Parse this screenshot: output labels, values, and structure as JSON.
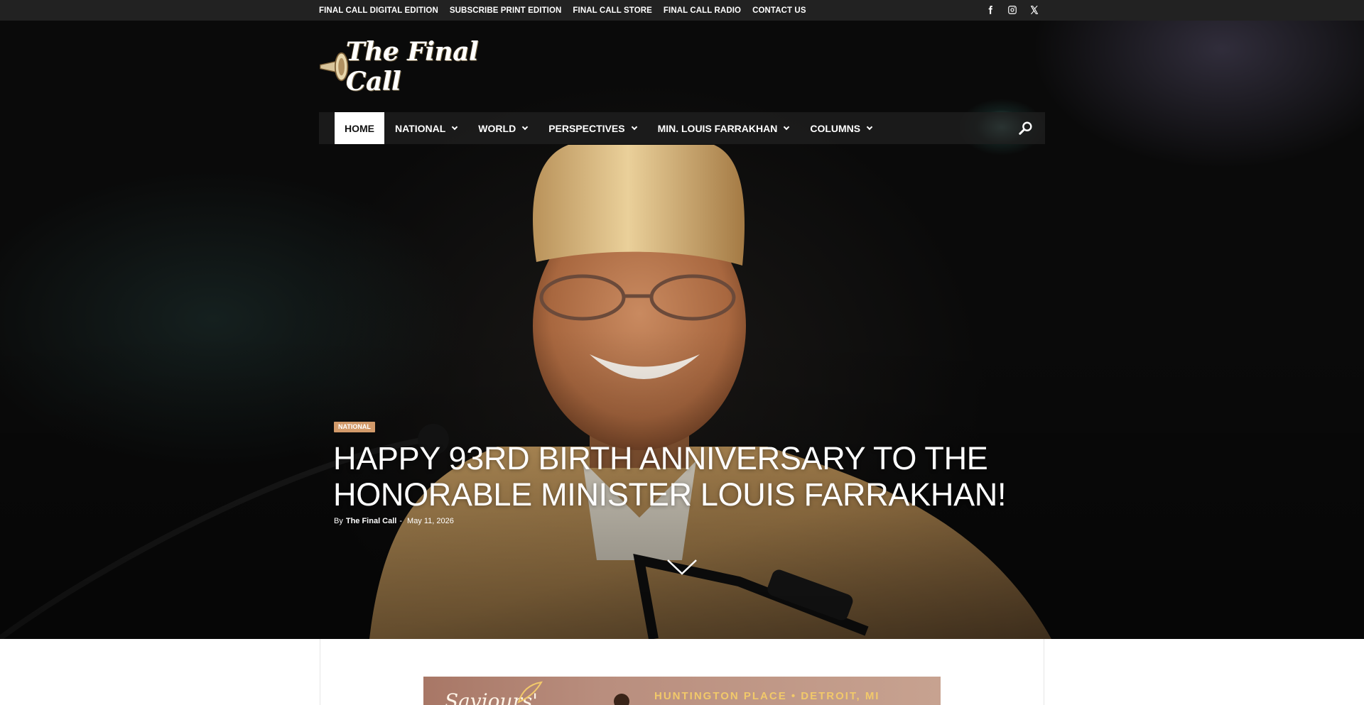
{
  "topbar": {
    "links": [
      "FINAL CALL DIGITAL EDITION",
      "SUBSCRIBE PRINT EDITION",
      "FINAL CALL STORE",
      "FINAL CALL RADIO",
      "CONTACT US"
    ],
    "socials": [
      "facebook-icon",
      "instagram-icon",
      "x-icon"
    ]
  },
  "logo": {
    "text": "The Final Call",
    "icon": "trumpet-icon"
  },
  "nav": {
    "items": [
      {
        "label": "HOME",
        "has_dropdown": false,
        "active": true
      },
      {
        "label": "NATIONAL",
        "has_dropdown": true
      },
      {
        "label": "WORLD",
        "has_dropdown": true
      },
      {
        "label": "PERSPECTIVES",
        "has_dropdown": true
      },
      {
        "label": "MIN. LOUIS FARRAKHAN",
        "has_dropdown": true
      },
      {
        "label": "COLUMNS",
        "has_dropdown": true
      }
    ],
    "search_icon": "search-icon"
  },
  "hero": {
    "category": "NATIONAL",
    "title": "HAPPY 93RD BIRTH ANNIVERSARY TO THE HONORABLE MINISTER LOUIS FARRAKHAN!",
    "by_prefix": "By",
    "author": "The Final Call",
    "separator": "-",
    "date": "May 11, 2026",
    "scroll_icon": "chevron-down-icon"
  },
  "ad": {
    "script_text": "Saviours'",
    "location": "HUNTINGTON PLACE • DETROIT, MI"
  },
  "colors": {
    "topbar_bg": "#222222",
    "badge": "#d29a6a",
    "ad_location": "#f2c96a"
  }
}
